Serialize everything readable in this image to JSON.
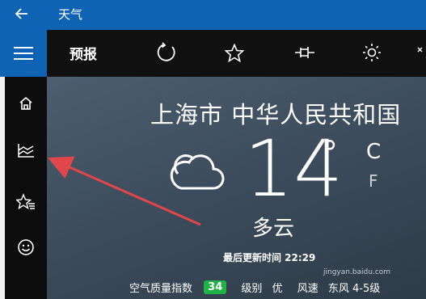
{
  "titlebar": {
    "back_icon": "arrow-left-icon",
    "title": "天气"
  },
  "toolbar": {
    "forecast_label": "预报",
    "icons": [
      "refresh-icon",
      "favorite-star-icon",
      "pin-icon",
      "brightness-icon"
    ]
  },
  "sidebar": {
    "icons": [
      "hamburger-menu-icon",
      "home-icon",
      "historical-weather-icon",
      "favorites-list-icon",
      "smiley-feedback-icon"
    ]
  },
  "weather": {
    "location": "上海市 中华人民共和国",
    "temperature": "14",
    "degree_symbol": "°",
    "unit_c": "C",
    "unit_f": "F",
    "condition": "多云",
    "condition_icon": "cloudy-icon",
    "updated": "最后更新时间 22:29",
    "aq_label": "空气质量指数",
    "aq_value": "34",
    "aq_value_color": "#1fb347",
    "level_label": "级别",
    "level_value": "优",
    "wind_label": "风速",
    "wind_value": "东风 4-5级"
  },
  "colors": {
    "accent": "#0f63b4",
    "annotation_arrow": "#e0464a"
  },
  "watermark": "jingyan.baidu.com"
}
